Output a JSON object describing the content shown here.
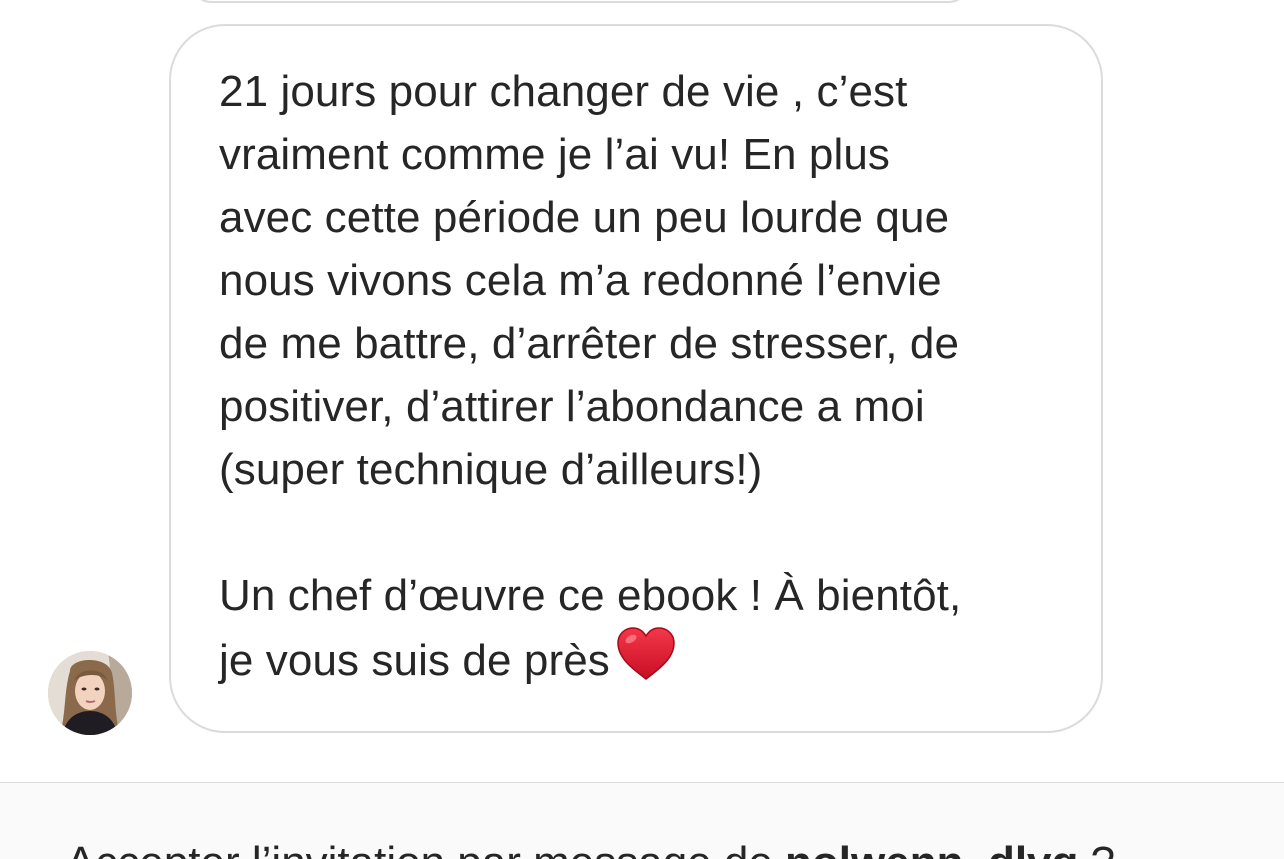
{
  "conversation": {
    "message": {
      "paragraph_1": "21 jours pour changer de vie , c’est\nvraiment  comme je l’ai vu! En plus\navec cette période un peu lourde que\nnous vivons cela m’a redonné l’envie\nde me battre, d’arrêter de stresser, de\npositiver, d’attirer l’abondance a moi\n(super technique d’ailleurs!)",
      "paragraph_2": "Un chef d’œuvre ce ebook ! À bientôt,\nje vous suis de près",
      "emoji": "heart-emoji"
    },
    "sender_avatar": "profile-photo"
  },
  "footer": {
    "prompt_prefix": "Accepter l’invitation par message de ",
    "username": "nolwenn_dlvg",
    "prompt_suffix": " ?"
  },
  "colors": {
    "text": "#262626",
    "bubble_border": "#dbdbdb",
    "footer_background": "#fafafa",
    "heart": "#e0132a"
  }
}
